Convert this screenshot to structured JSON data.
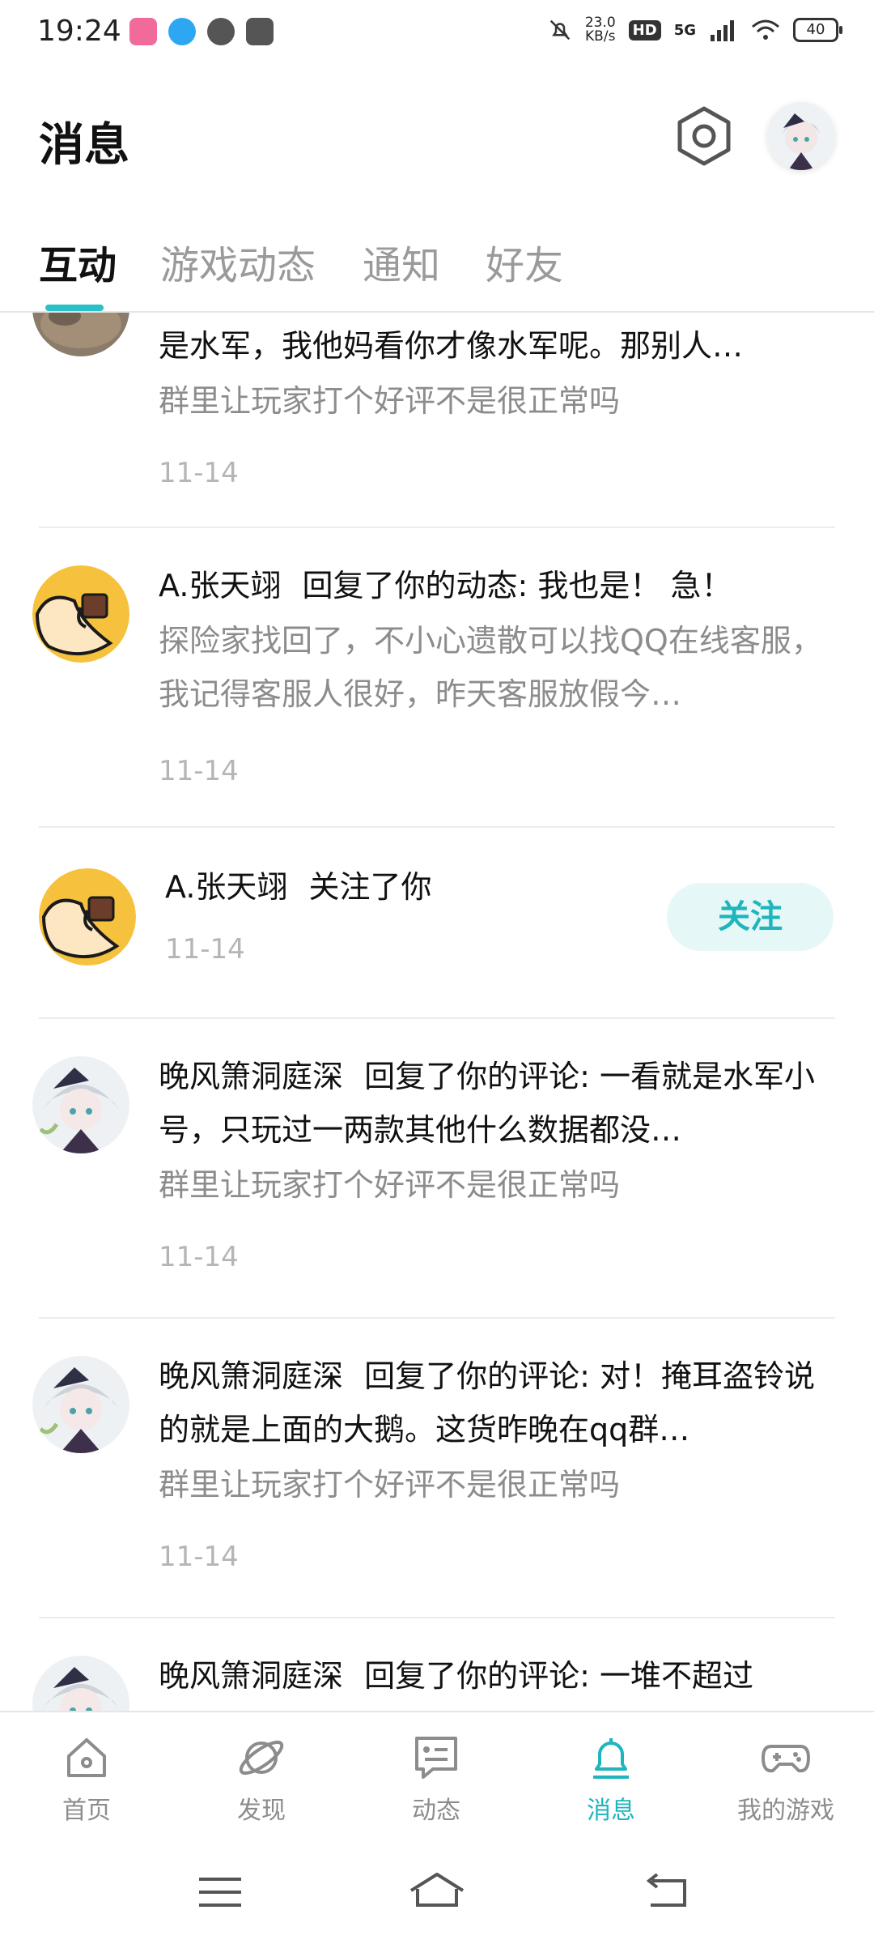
{
  "status_bar": {
    "time": "19:24",
    "net_speed_value": "23.0",
    "net_speed_unit": "KB/s",
    "hd_label": "HD",
    "network": "5G",
    "battery": "40",
    "icons": [
      "app-icon-1",
      "app-icon-2",
      "app-icon-3",
      "app-icon-4",
      "mute-bell-icon",
      "signal-icon",
      "wifi-icon"
    ]
  },
  "header": {
    "title": "消息",
    "settings_icon": "settings-icon",
    "avatar": "user-avatar"
  },
  "tabs": [
    {
      "label": "互动",
      "active": true
    },
    {
      "label": "游戏动态",
      "active": false
    },
    {
      "label": "通知",
      "active": false
    },
    {
      "label": "好友",
      "active": false
    }
  ],
  "feed": {
    "items": [
      {
        "primary": "是水军，我他妈看你才像水军呢。那别人…",
        "secondary": "群里让玩家打个好评不是很正常吗",
        "date": "11-14"
      },
      {
        "user": "A.张天翊",
        "action": "回复了你的动态: 我也是！ 急！",
        "secondary": "探险家找回了，不小心遗散可以找QQ在线客服，我记得客服人很好，昨天客服放假今…",
        "date": "11-14"
      },
      {
        "user": "A.张天翊",
        "action": "关注了你",
        "date": "11-14",
        "button": "关注"
      },
      {
        "user": "晚风箫洞庭深",
        "action": "回复了你的评论: 一看就是水军小号，只玩过一两款其他什么数据都没…",
        "secondary": "群里让玩家打个好评不是很正常吗",
        "date": "11-14"
      },
      {
        "user": "晚风箫洞庭深",
        "action": "回复了你的评论: 对！掩耳盗铃说的就是上面的大鹅。这货昨晚在qq群…",
        "secondary": "群里让玩家打个好评不是很正常吗",
        "date": "11-14"
      },
      {
        "user": "晚风箫洞庭深",
        "action": "回复了你的评论: 一堆不超过"
      }
    ]
  },
  "bottom_nav": [
    {
      "label": "首页",
      "icon": "home-icon",
      "active": false
    },
    {
      "label": "发现",
      "icon": "planet-icon",
      "active": false
    },
    {
      "label": "动态",
      "icon": "chat-card-icon",
      "active": false
    },
    {
      "label": "消息",
      "icon": "bell-icon",
      "active": true
    },
    {
      "label": "我的游戏",
      "icon": "gamepad-icon",
      "active": false
    }
  ],
  "system_nav": [
    "menu-icon",
    "home-outline-icon",
    "back-icon"
  ],
  "colors": {
    "accent": "#1fb5bd",
    "indicator": "#29c0c7",
    "muted": "#8c8c8c",
    "date": "#b5b5b5"
  }
}
